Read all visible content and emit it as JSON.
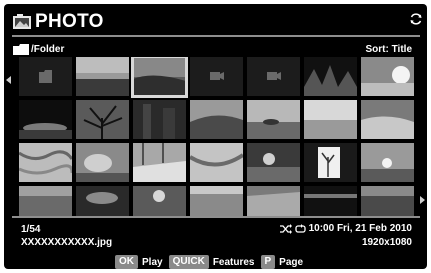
{
  "header": {
    "title": "PHOTO",
    "title_icon": "photo-icon",
    "refresh_icon": "refresh-icon"
  },
  "location": {
    "folder_path": "/Folder",
    "folder_icon": "folder-icon",
    "sort_label": "Sort: Title"
  },
  "grid": {
    "selected_index": 2,
    "cells": [
      {
        "kind": "folder"
      },
      {
        "kind": "photo"
      },
      {
        "kind": "photo"
      },
      {
        "kind": "video"
      },
      {
        "kind": "video"
      },
      {
        "kind": "photo"
      },
      {
        "kind": "photo"
      },
      {
        "kind": "photo"
      },
      {
        "kind": "photo"
      },
      {
        "kind": "photo"
      },
      {
        "kind": "photo"
      },
      {
        "kind": "photo"
      },
      {
        "kind": "photo"
      },
      {
        "kind": "photo"
      },
      {
        "kind": "photo"
      },
      {
        "kind": "photo"
      },
      {
        "kind": "photo"
      },
      {
        "kind": "photo"
      },
      {
        "kind": "photo"
      },
      {
        "kind": "photo"
      },
      {
        "kind": "photo"
      },
      {
        "kind": "photo"
      },
      {
        "kind": "photo"
      },
      {
        "kind": "photo"
      },
      {
        "kind": "photo"
      },
      {
        "kind": "photo"
      },
      {
        "kind": "photo"
      },
      {
        "kind": "photo"
      }
    ]
  },
  "status": {
    "position": "1/54",
    "filename": "XXXXXXXXXXX.jpg",
    "datetime": "10:00 Fri, 21 Feb 2010",
    "resolution": "1920x1080",
    "shuffle_icon": "shuffle-icon",
    "repeat_icon": "repeat-icon"
  },
  "footer": {
    "ok_key": "OK",
    "ok_label": "Play",
    "quick_key": "QUICK",
    "quick_label": "Features",
    "p_key": "P",
    "p_label": "Page"
  },
  "colors": {
    "background": "#000000",
    "divider": "#8e8e8e",
    "key_background": "#8a8a8a",
    "selection": "#d8d8d8"
  }
}
